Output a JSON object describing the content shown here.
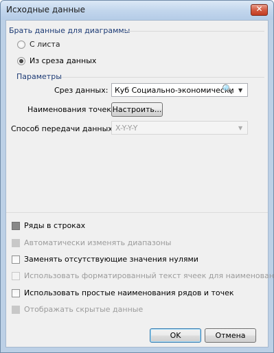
{
  "window": {
    "title": "Исходные данные",
    "close_label": "✕"
  },
  "source_group": {
    "label": "Брать данные для диаграммы",
    "options": [
      {
        "label": "С листа",
        "checked": false
      },
      {
        "label": "Из среза данных",
        "checked": true
      }
    ]
  },
  "params": {
    "label": "Параметры",
    "slice_label": "Срез данных:",
    "slice_value": "Куб Социально-экономически",
    "points_label": "Наименования точек:",
    "points_button": "Настроить...",
    "transfer_label": "Способ передачи данных:",
    "transfer_value": "X-Y-Y-Y"
  },
  "options": [
    {
      "label": "Ряды в строках",
      "checked": true,
      "enabled": true
    },
    {
      "label": "Автоматически изменять диапазоны",
      "checked": true,
      "enabled": false
    },
    {
      "label": "Заменять отсутствующие значения нулями",
      "checked": false,
      "enabled": true
    },
    {
      "label": "Использовать форматированный текст ячеек для наименований",
      "checked": false,
      "enabled": false
    },
    {
      "label": "Использовать простые наименования рядов и точек",
      "checked": false,
      "enabled": true
    },
    {
      "label": "Отображать скрытые данные",
      "checked": true,
      "enabled": false
    }
  ],
  "buttons": {
    "ok": "OK",
    "cancel": "Отмена"
  }
}
